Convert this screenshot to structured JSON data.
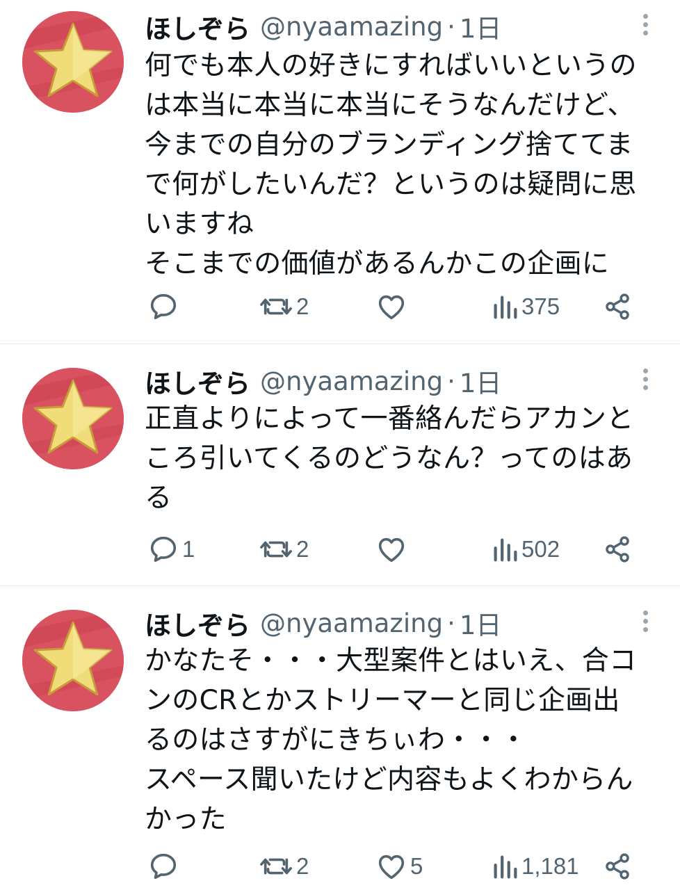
{
  "tweets": [
    {
      "name": "ほしぞら",
      "handle": "@nyaamazing",
      "separator": "·",
      "time": "1日",
      "lines": [
        "何でも本人の好きにすればいいというの",
        "は本当に本当に本当にそうなんだけど、",
        "今までの自分のブランディング捨ててま",
        "で何がしたいんだ？というのは疑問に思",
        "いますね",
        "そこまでの価値があるんかこの企画に"
      ],
      "replies": "",
      "retweets": "2",
      "likes": "",
      "views": "375"
    },
    {
      "name": "ほしぞら",
      "handle": "@nyaamazing",
      "separator": "·",
      "time": "1日",
      "lines": [
        "正直よりによって一番絡んだらアカンと",
        "ころ引いてくるのどうなん？ってのはあ",
        "る"
      ],
      "replies": "1",
      "retweets": "2",
      "likes": "",
      "views": "502"
    },
    {
      "name": "ほしぞら",
      "handle": "@nyaamazing",
      "separator": "·",
      "time": "1日",
      "lines": [
        "かなたそ・・・大型案件とはいえ、合コ",
        "ンのCRとかストリーマーと同じ企画出",
        "るのはさすがにきちぃわ・・・",
        "スペース聞いたけど内容もよくわからん",
        "かった"
      ],
      "replies": "",
      "retweets": "2",
      "likes": "5",
      "views": "1,181"
    }
  ],
  "icons": {
    "avatar": "star-avatar-icon",
    "reply": "reply-icon",
    "retweet": "retweet-icon",
    "like": "heart-icon",
    "views": "views-chart-icon",
    "share": "share-icon",
    "more": "more-vertical-icon"
  },
  "colors": {
    "text": "#0f1419",
    "secondary": "#536471",
    "avatar_bg": "#d9525f",
    "star": "#f1dc7a",
    "divider": "#e6e9ec"
  }
}
